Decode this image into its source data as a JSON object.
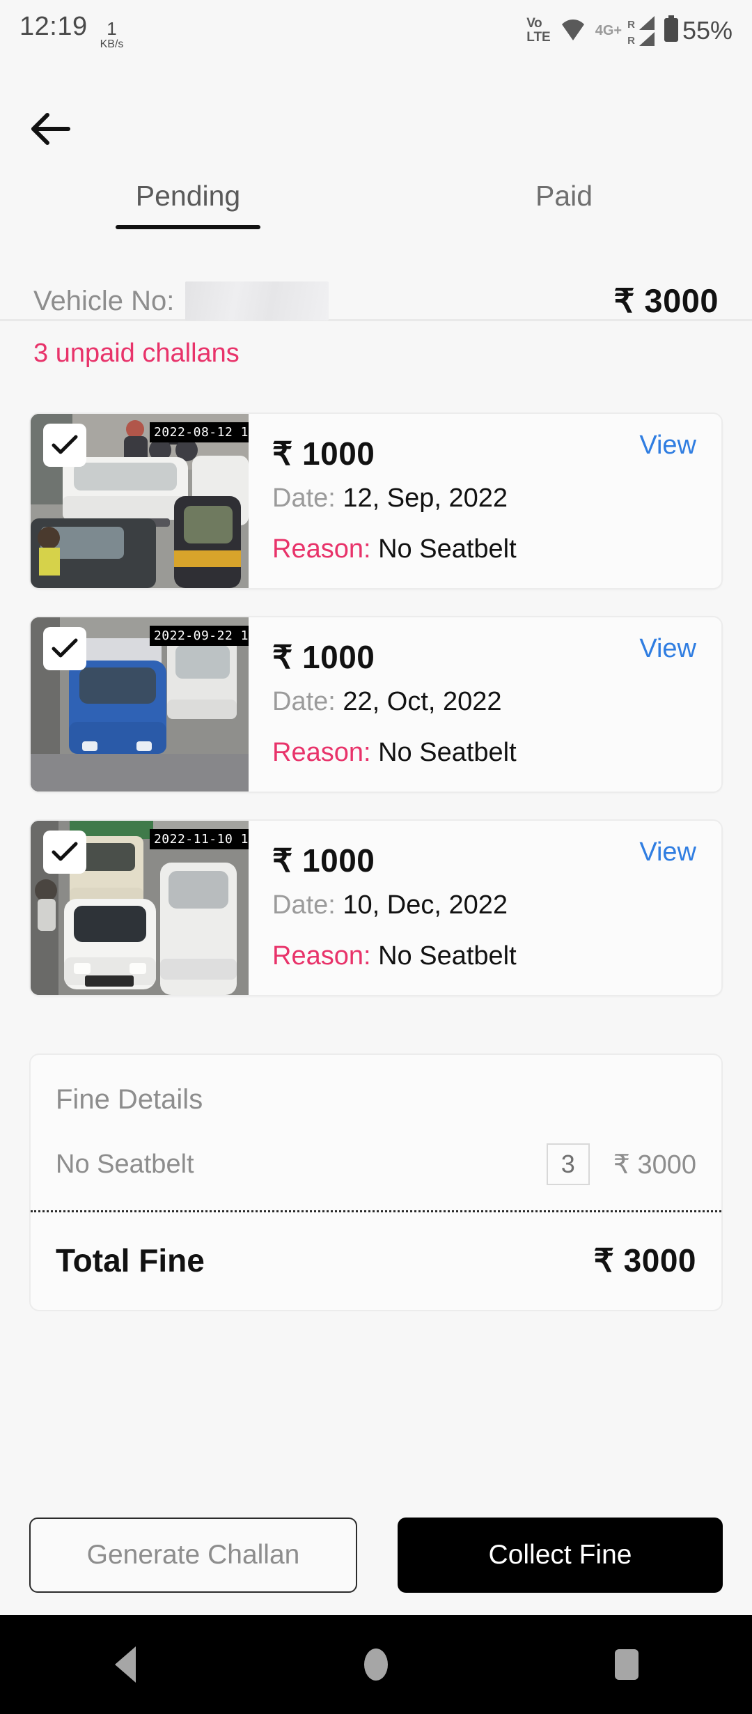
{
  "status_bar": {
    "time": "12:19",
    "net_speed_value": "1",
    "net_speed_unit": "KB/s",
    "volte_top": "Vo",
    "volte_bottom": "LTE",
    "network_type": "4G+",
    "sim1_roaming": "R",
    "sim2_roaming": "R",
    "battery": "55%"
  },
  "app_bar": {
    "back_icon": "back-arrow-icon",
    "tabs": [
      {
        "label": "Pending",
        "active": true
      },
      {
        "label": "Paid",
        "active": false
      }
    ]
  },
  "summary": {
    "vehicle_label": "Vehicle No:",
    "vehicle_number": "",
    "total_amount": "₹ 3000",
    "unpaid_text": "3 unpaid challans"
  },
  "challans": [
    {
      "selected": true,
      "timestamp": "2022-08-12 1",
      "amount": "₹ 1000",
      "date_label": "Date:",
      "date_value": "12, Sep, 2022",
      "reason_label": "Reason:",
      "reason_value": "No Seatbelt",
      "view_label": "View"
    },
    {
      "selected": true,
      "timestamp": "2022-09-22 1",
      "amount": "₹ 1000",
      "date_label": "Date:",
      "date_value": "22, Oct, 2022",
      "reason_label": "Reason:",
      "reason_value": "No Seatbelt",
      "view_label": "View"
    },
    {
      "selected": true,
      "timestamp": "2022-11-10 1",
      "amount": "₹ 1000",
      "date_label": "Date:",
      "date_value": "10, Dec, 2022",
      "reason_label": "Reason:",
      "reason_value": "No Seatbelt",
      "view_label": "View"
    }
  ],
  "fine_details": {
    "title": "Fine Details",
    "rows": [
      {
        "name": "No Seatbelt",
        "qty": "3",
        "amount": "₹ 3000"
      }
    ],
    "total_label": "Total Fine",
    "total_amount": "₹ 3000"
  },
  "actions": {
    "secondary_label": "Generate Challan",
    "primary_label": "Collect Fine"
  },
  "nav_bar": {
    "back": "triangle-back-icon",
    "home": "circle-home-icon",
    "recents": "square-recents-icon"
  },
  "colors": {
    "accent_pink": "#e8336a",
    "link_blue": "#2f7de1",
    "background": "#f7f7f7",
    "primary_button": "#000000"
  }
}
